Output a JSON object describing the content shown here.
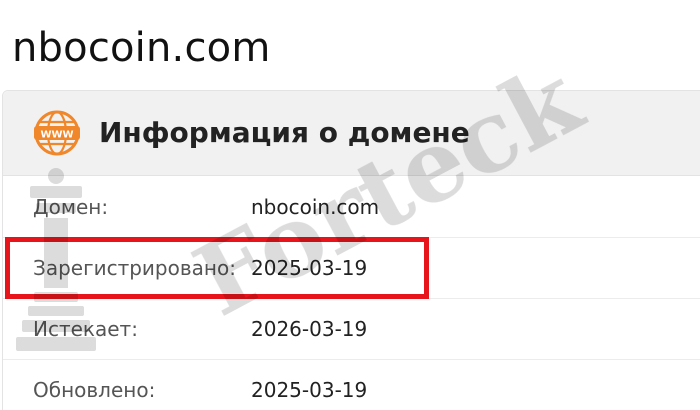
{
  "site": {
    "title": "nbocoin.com"
  },
  "card": {
    "icon": "www-globe-icon",
    "title": "Информация о домене",
    "rows": [
      {
        "label": "Домен:",
        "value": "nbocoin.com"
      },
      {
        "label": "Зарегистрировано:",
        "value": "2025-03-19"
      },
      {
        "label": "Истекает:",
        "value": "2026-03-19"
      },
      {
        "label": "Обновлено:",
        "value": "2025-03-19"
      }
    ]
  },
  "watermark": {
    "text": "Forteck"
  },
  "colors": {
    "highlight": "#e8141b",
    "icon": "#f0872b",
    "header_bg": "#f1f1f1"
  }
}
